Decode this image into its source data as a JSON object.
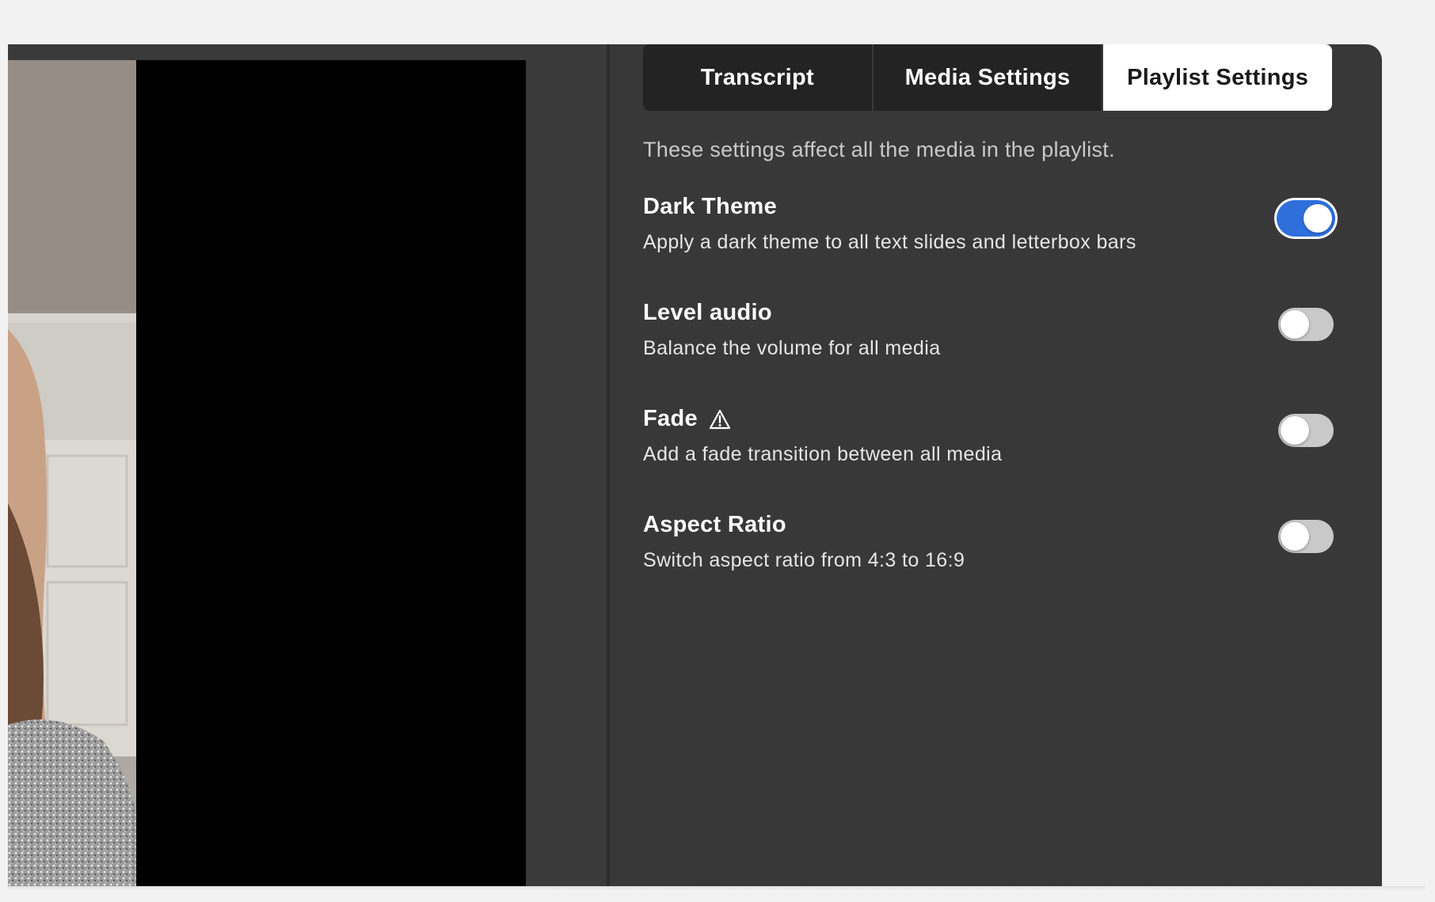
{
  "tabs": [
    {
      "label": "Transcript",
      "active": false
    },
    {
      "label": "Media Settings",
      "active": false
    },
    {
      "label": "Playlist Settings",
      "active": true
    }
  ],
  "intro": "These settings affect all the media in the playlist.",
  "settings": [
    {
      "title": "Dark Theme",
      "description": "Apply a dark theme to all text slides and letterbox bars",
      "enabled": true
    },
    {
      "title": "Level audio",
      "description": "Balance the volume for all media",
      "enabled": false
    },
    {
      "title": "Fade",
      "description": "Add a fade transition between all media",
      "enabled": false,
      "icon": "warning-icon"
    },
    {
      "title": "Aspect Ratio",
      "description": "Switch aspect ratio from 4:3 to 16:9",
      "enabled": false
    }
  ],
  "colors": {
    "panel_bg": "#383838",
    "toggle_on": "#2e6fdc",
    "toggle_off": "#c9c9c9",
    "tab_bg": "#232323",
    "tab_active_bg": "#ffffff"
  }
}
